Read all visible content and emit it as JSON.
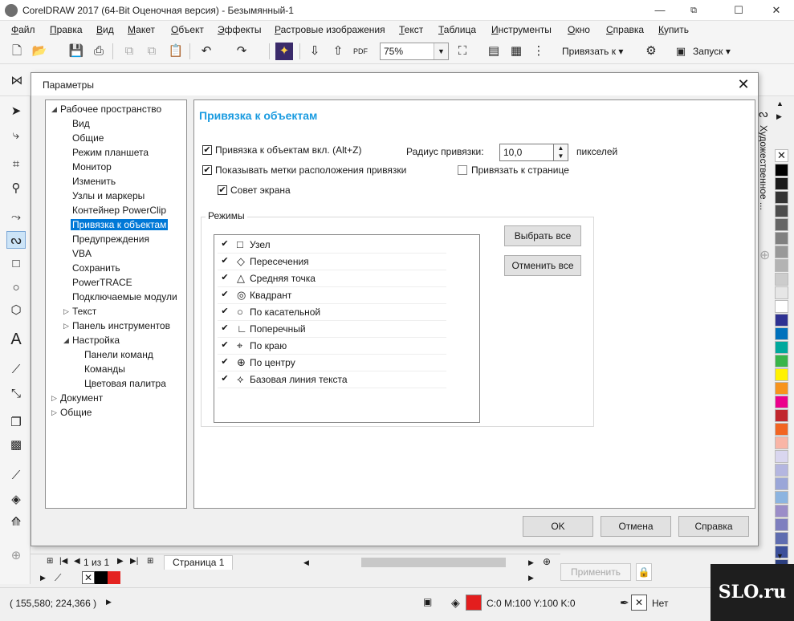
{
  "app": {
    "title": "CorelDRAW 2017 (64-Bit Оценочная версия) - Безымянный-1",
    "window_controls": [
      "—",
      "☐",
      "✕"
    ],
    "restore_icon": "⧉"
  },
  "menubar": [
    "Файл",
    "Правка",
    "Вид",
    "Макет",
    "Объект",
    "Эффекты",
    "Растровые изображения",
    "Текст",
    "Таблица",
    "Инструменты",
    "Окно",
    "Справка",
    "Купить"
  ],
  "toolbar": {
    "zoom": "75%",
    "snap_label": "Привязать к",
    "launch_label": "Запуск"
  },
  "dialog": {
    "title": "Параметры",
    "close": "✕",
    "tree": [
      {
        "label": "Рабочее пространство",
        "level": 0,
        "caret": "◢"
      },
      {
        "label": "Вид",
        "level": 1
      },
      {
        "label": "Общие",
        "level": 1
      },
      {
        "label": "Режим планшета",
        "level": 1
      },
      {
        "label": "Монитор",
        "level": 1
      },
      {
        "label": "Изменить",
        "level": 1
      },
      {
        "label": "Узлы и маркеры",
        "level": 1
      },
      {
        "label": "Контейнер PowerClip",
        "level": 1
      },
      {
        "label": "Привязка к объектам",
        "level": 1,
        "selected": true
      },
      {
        "label": "Предупреждения",
        "level": 1
      },
      {
        "label": "VBA",
        "level": 1
      },
      {
        "label": "Сохранить",
        "level": 1
      },
      {
        "label": "PowerTRACE",
        "level": 1
      },
      {
        "label": "Подключаемые модули",
        "level": 1
      },
      {
        "label": "Текст",
        "level": 1,
        "caret": "▷"
      },
      {
        "label": "Панель инструментов",
        "level": 1,
        "caret": "▷"
      },
      {
        "label": "Настройка",
        "level": 1,
        "caret": "◢"
      },
      {
        "label": "Панели команд",
        "level": 2
      },
      {
        "label": "Команды",
        "level": 2
      },
      {
        "label": "Цветовая палитра",
        "level": 2
      },
      {
        "label": "Документ",
        "level": 0,
        "caret": "▷"
      },
      {
        "label": "Общие",
        "level": 0,
        "caret": "▷"
      }
    ],
    "panel": {
      "title": "Привязка к объектам",
      "snap_on": {
        "label": "Привязка к объектам вкл. (Alt+Z)",
        "checked": true
      },
      "show_marks": {
        "label": "Показывать метки расположения привязки",
        "checked": true
      },
      "screen_tip": {
        "label": "Совет экрана",
        "checked": true
      },
      "radius_label": "Радиус привязки:",
      "radius_value": "10,0",
      "radius_unit": "пикселей",
      "snap_page": {
        "label": "Привязать к странице",
        "checked": false
      },
      "modes_title": "Режимы",
      "modes": [
        {
          "label": "Узел",
          "icon": "□",
          "checked": true
        },
        {
          "label": "Пересечения",
          "icon": "◇",
          "checked": true
        },
        {
          "label": "Средняя точка",
          "icon": "△",
          "checked": true
        },
        {
          "label": "Квадрант",
          "icon": "◎",
          "checked": true
        },
        {
          "label": "По касательной",
          "icon": "○",
          "checked": true
        },
        {
          "label": "Поперечный",
          "icon": "∟",
          "checked": true
        },
        {
          "label": "По краю",
          "icon": "⌖",
          "checked": true
        },
        {
          "label": "По центру",
          "icon": "⊕",
          "checked": true
        },
        {
          "label": "Базовая линия текста",
          "icon": "⟡",
          "checked": true
        }
      ],
      "select_all": "Выбрать все",
      "deselect_all": "Отменить все"
    },
    "buttons": {
      "ok": "OK",
      "cancel": "Отмена",
      "help": "Справка"
    }
  },
  "docker": {
    "tab_label": "Художественное ..."
  },
  "pagebar": {
    "page_of": "1 из 1",
    "page_tab": "Страница 1"
  },
  "apply_button": "Применить",
  "status": {
    "coords": "( 155,580; 224,366 )",
    "fill": "C:0 M:100 Y:100 K:0",
    "outline": "Нет"
  },
  "palette_colors": [
    "#000000",
    "#1a1a1a",
    "#333333",
    "#4d4d4d",
    "#666666",
    "#808080",
    "#999999",
    "#b3b3b3",
    "#cccccc",
    "#e6e6e6",
    "#ffffff",
    "#2e3192",
    "#0071bc",
    "#00a99d",
    "#39b54a",
    "#fff200",
    "#f7941d",
    "#ec008c",
    "#c1272d",
    "#f26522",
    "#f9b5a6",
    "#d9d6ef",
    "#b4b6e0",
    "#9aa6d8",
    "#8cb4e0",
    "#9b8dc8",
    "#7e7fbf",
    "#5f6db0",
    "#3b4f9a",
    "#2c3f80",
    "#1e3570"
  ],
  "watermark": "SLO.ru"
}
